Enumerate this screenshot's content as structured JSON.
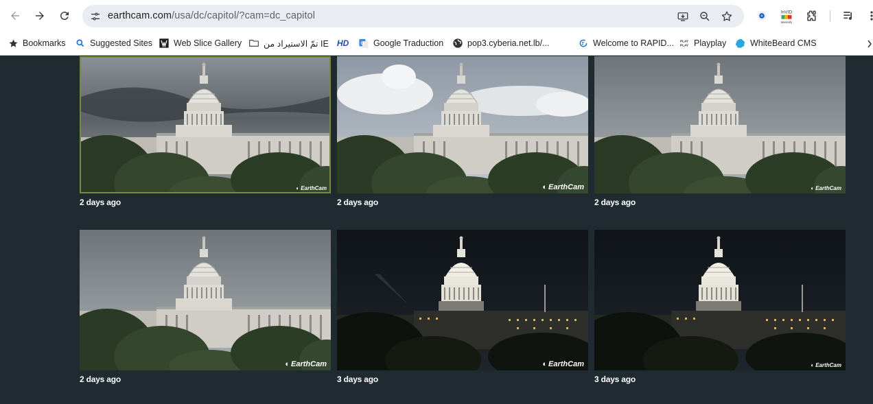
{
  "browser": {
    "url_host": "earthcam.com",
    "url_path": "/usa/dc/capitol/?cam=dc_capitol",
    "back_icon": "arrow-left-icon",
    "forward_icon": "arrow-right-icon",
    "reload_icon": "reload-icon",
    "invid_label_top": "InVID",
    "invid_label_bottom": "WeVerify"
  },
  "bookmarks": [
    {
      "label": "Bookmarks",
      "icon": "star-icon"
    },
    {
      "label": "Suggested Sites",
      "icon": "search-icon"
    },
    {
      "label": "Web Slice Gallery",
      "icon": "web-slice-icon"
    },
    {
      "label": "تمّ الاستيراد من IE",
      "icon": "folder-icon"
    },
    {
      "label": "HD",
      "icon": "hd-icon"
    },
    {
      "label": "Google Traduction",
      "icon": "google-translate-icon"
    },
    {
      "label": "pop3.cyberia.net.lb/...",
      "icon": "globe-icon"
    },
    {
      "label": "Welcome to RAPID...",
      "icon": "rapid-icon"
    },
    {
      "label": "Playplay",
      "icon": "playplay-icon"
    },
    {
      "label": "WhiteBeard CMS",
      "icon": "whitebeard-icon"
    }
  ],
  "thumbnails": [
    {
      "caption": "2 days ago",
      "brand": "EarthCam",
      "scene": "storm"
    },
    {
      "caption": "2 days ago",
      "brand": "EarthCam",
      "scene": "clouds"
    },
    {
      "caption": "2 days ago",
      "brand": "EarthCam",
      "scene": "overcast"
    },
    {
      "caption": "2 days ago",
      "brand": "EarthCam",
      "scene": "overcast"
    },
    {
      "caption": "3 days ago",
      "brand": "EarthCam",
      "scene": "night"
    },
    {
      "caption": "3 days ago",
      "brand": "EarthCam",
      "scene": "night"
    }
  ]
}
